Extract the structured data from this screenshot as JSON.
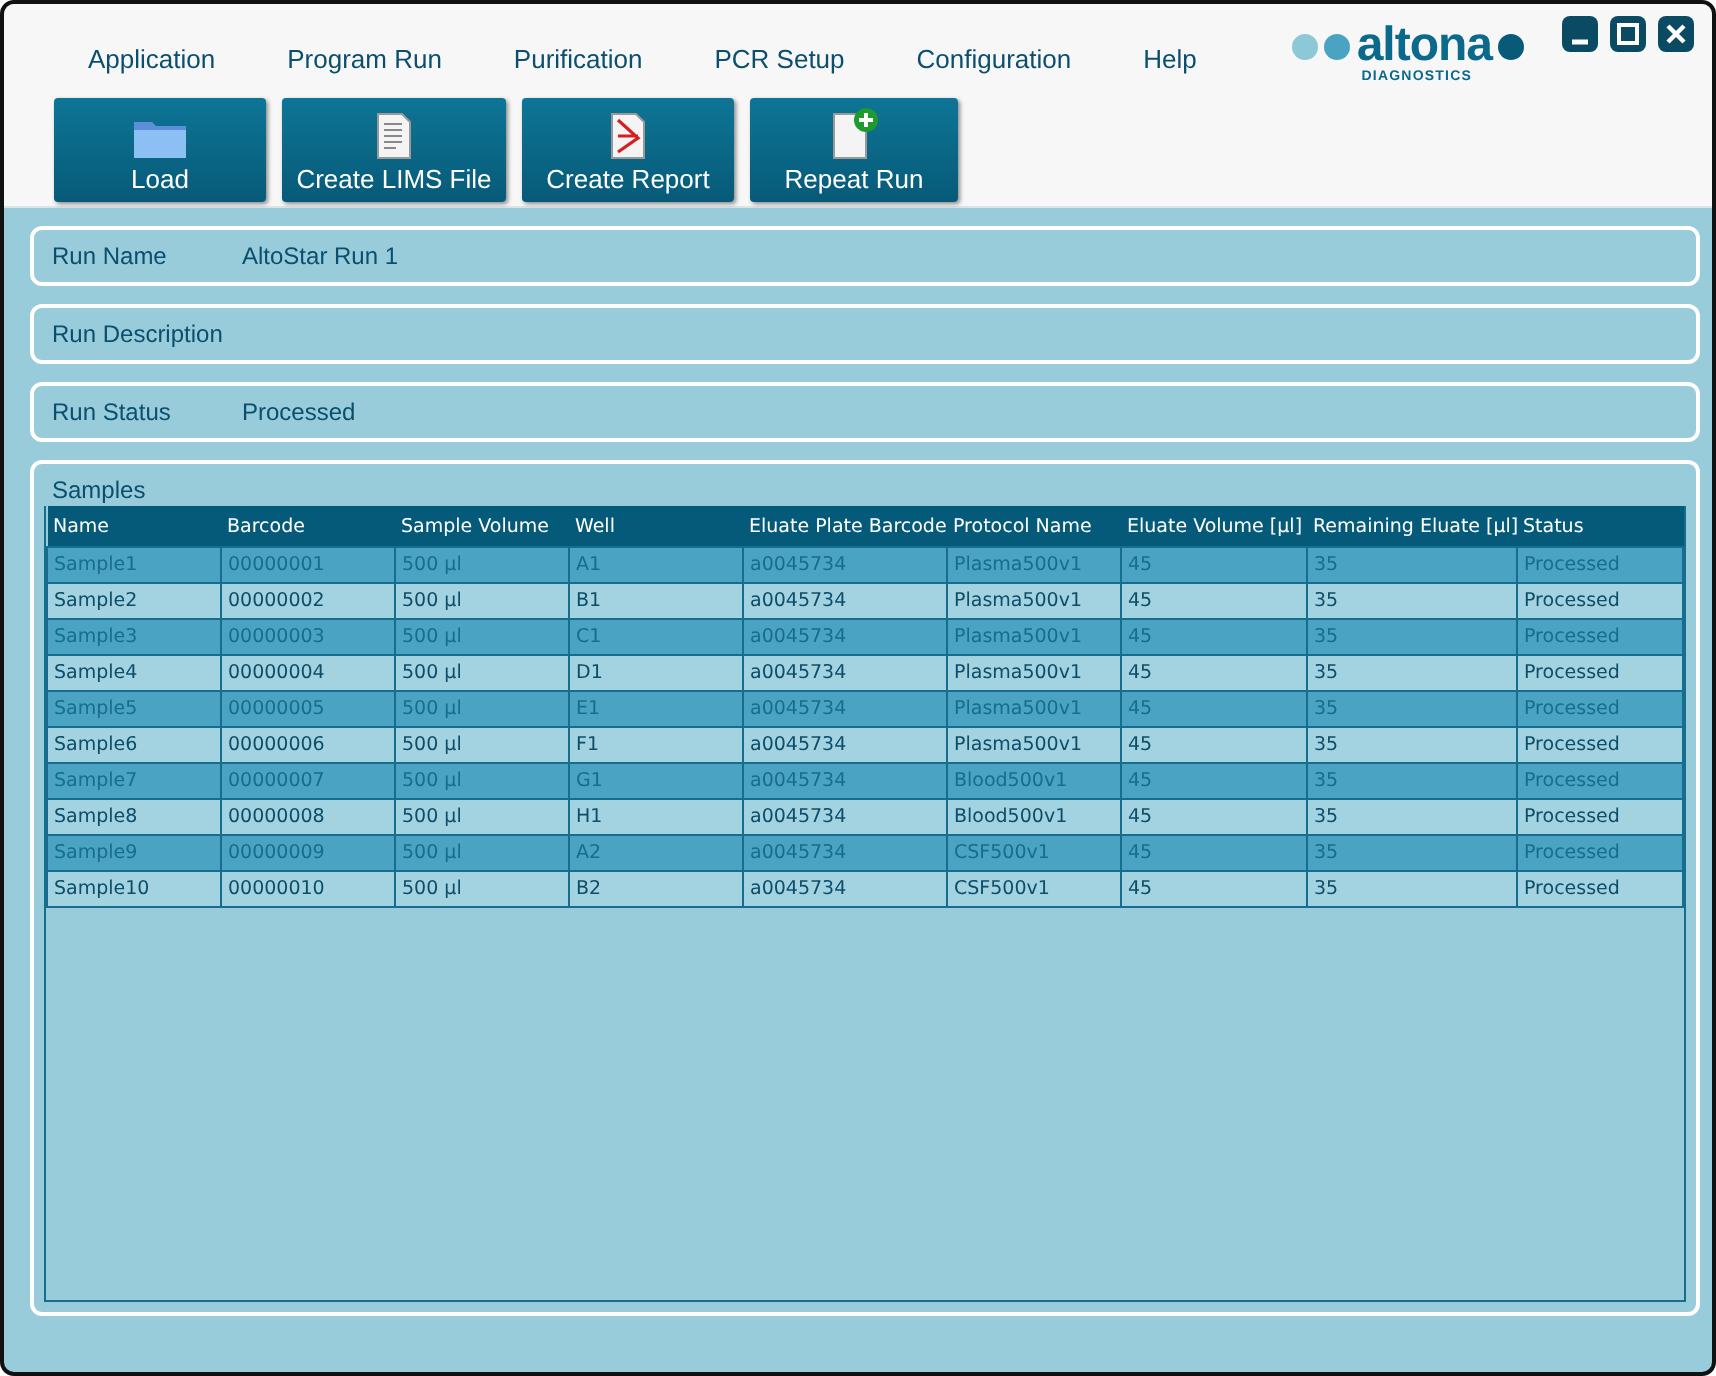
{
  "menu": [
    "Application",
    "Program Run",
    "Purification",
    "PCR Setup",
    "Configuration",
    "Help"
  ],
  "logo": {
    "name": "altona",
    "subtitle": "DIAGNOSTICS"
  },
  "toolbar": [
    {
      "label": "Load",
      "kind": "folder"
    },
    {
      "label": "Create LIMS File",
      "kind": "document"
    },
    {
      "label": "Create Report",
      "kind": "pdf"
    },
    {
      "label": "Repeat Run",
      "kind": "add-document"
    }
  ],
  "fields": [
    {
      "label": "Run Name",
      "value": "AltoStar Run 1"
    },
    {
      "label": "Run Description"
    },
    {
      "label": "Run Status",
      "value": "Processed"
    }
  ],
  "samples": {
    "title": "Samples",
    "columns": [
      "Name",
      "Barcode",
      "Sample Volume",
      "Well",
      "Eluate Plate Barcode",
      "Protocol Name",
      "Eluate Volume [µl]",
      "Remaining Eluate [µl]",
      "Status"
    ],
    "rows": [
      [
        "Sample1",
        "00000001",
        "500 µl",
        "A1",
        "a0045734",
        "Plasma500v1",
        "45",
        "35",
        "Processed"
      ],
      [
        "Sample2",
        "00000002",
        "500 µl",
        "B1",
        "a0045734",
        "Plasma500v1",
        "45",
        "35",
        "Processed"
      ],
      [
        "Sample3",
        "00000003",
        "500 µl",
        "C1",
        "a0045734",
        "Plasma500v1",
        "45",
        "35",
        "Processed"
      ],
      [
        "Sample4",
        "00000004",
        "500 µl",
        "D1",
        "a0045734",
        "Plasma500v1",
        "45",
        "35",
        "Processed"
      ],
      [
        "Sample5",
        "00000005",
        "500 µl",
        "E1",
        "a0045734",
        "Plasma500v1",
        "45",
        "35",
        "Processed"
      ],
      [
        "Sample6",
        "00000006",
        "500 µl",
        "F1",
        "a0045734",
        "Plasma500v1",
        "45",
        "35",
        "Processed"
      ],
      [
        "Sample7",
        "00000007",
        "500 µl",
        "G1",
        "a0045734",
        "Blood500v1",
        "45",
        "35",
        "Processed"
      ],
      [
        "Sample8",
        "00000008",
        "500 µl",
        "H1",
        "a0045734",
        "Blood500v1",
        "45",
        "35",
        "Processed"
      ],
      [
        "Sample9",
        "00000009",
        "500 µl",
        "A2",
        "a0045734",
        "CSF500v1",
        "45",
        "35",
        "Processed"
      ],
      [
        "Sample10",
        "00000010",
        "500 µl",
        "B2",
        "a0045734",
        "CSF500v1",
        "45",
        "35",
        "Processed"
      ]
    ]
  }
}
